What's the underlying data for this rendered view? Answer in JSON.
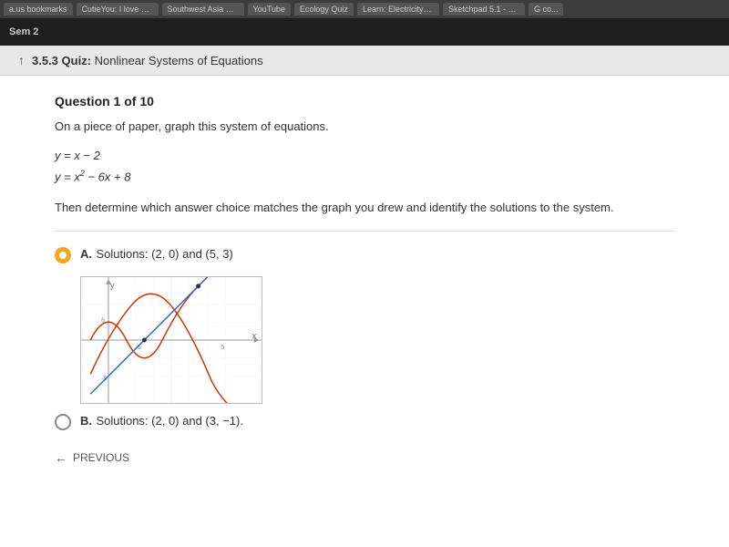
{
  "browser": {
    "tabs": [
      {
        "label": "a.us bookmarks",
        "active": false
      },
      {
        "label": "CutieYou: I love you...",
        "active": false
      },
      {
        "label": "Southwest Asia His...",
        "active": false
      },
      {
        "label": "YouTube",
        "active": false
      },
      {
        "label": "Ecology Quiz",
        "active": false
      },
      {
        "label": "Learn: Electricity Re...",
        "active": false
      },
      {
        "label": "Sketchpad 5.1 - Dra...",
        "active": false
      },
      {
        "label": "G co...",
        "active": false
      }
    ]
  },
  "top_bar": {
    "label": "Sem 2"
  },
  "quiz_header": {
    "icon": "↑",
    "bold": "3.5.3 Quiz:",
    "title": "Nonlinear Systems of Equations"
  },
  "question": {
    "label": "Question 1 of 10",
    "text": "On a piece of paper, graph this system of equations.",
    "equations": [
      "y = x − 2",
      "y = x² − 6x + 8"
    ],
    "follow_text": "Then determine which answer choice matches the graph you drew and identify the solutions to the system."
  },
  "answers": [
    {
      "id": "A",
      "selected": true,
      "text": "Solutions: (2, 0) and (5, 3)"
    },
    {
      "id": "B",
      "selected": false,
      "text": "Solutions: (2, 0) and (3, −1)."
    }
  ],
  "navigation": {
    "previous_label": "PREVIOUS"
  }
}
